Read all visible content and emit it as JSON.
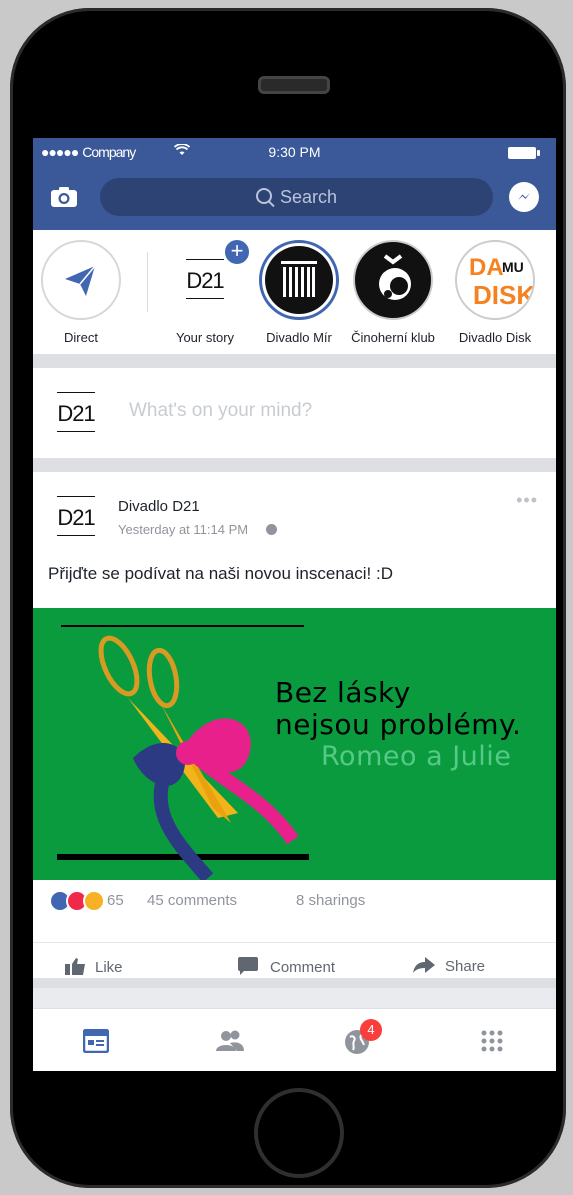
{
  "status_bar": {
    "signal": "●●●●●",
    "carrier": "Company",
    "time": "9:30 PM"
  },
  "header": {
    "search_placeholder": "Search"
  },
  "stories": [
    {
      "label": "Direct"
    },
    {
      "label": "Your story",
      "logo": "D21"
    },
    {
      "label": "Divadlo Mír",
      "logo": "MIR"
    },
    {
      "label": "Činoherní klub",
      "logo": "č"
    },
    {
      "label": "Divadlo Disk",
      "logo": "DA MU DISK"
    }
  ],
  "composer": {
    "avatar": "D21",
    "placeholder": "What's on your mind?"
  },
  "post": {
    "avatar": "D21",
    "author": "Divadlo D21",
    "time": "Yesterday at 11:14 PM",
    "text": "Přijďte se podívat na naši novou inscenaci! :D",
    "image": {
      "line1": "Bez lásky",
      "line2": "nejsou problémy.",
      "line3": "Romeo a Julie"
    },
    "reactions_count": "65",
    "comments": "45 comments",
    "shares": "8 sharings",
    "actions": {
      "like": "Like",
      "comment": "Comment",
      "share": "Share"
    }
  },
  "tabbar": {
    "notifications_badge": "4"
  },
  "colors": {
    "facebook_blue": "#3b5998",
    "post_image_green": "#0a9b3f",
    "badge_red": "#fa3e3e"
  }
}
